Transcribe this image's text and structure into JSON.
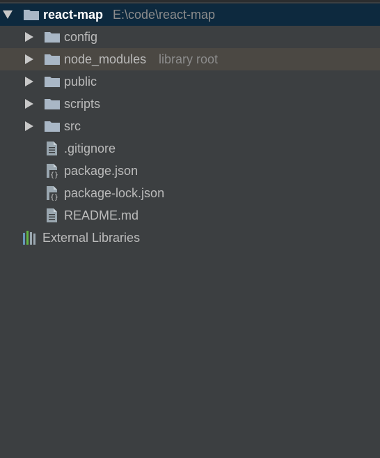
{
  "project_tree": {
    "root": {
      "name": "react-map",
      "path": "E:\\code\\react-map",
      "expanded": true,
      "icon": "folder-icon"
    },
    "folders": [
      {
        "name": "config",
        "hint": "",
        "icon": "folder-icon"
      },
      {
        "name": "node_modules",
        "hint": "library root",
        "icon": "folder-icon"
      },
      {
        "name": "public",
        "hint": "",
        "icon": "folder-icon"
      },
      {
        "name": "scripts",
        "hint": "",
        "icon": "folder-icon"
      },
      {
        "name": "src",
        "hint": "",
        "icon": "folder-icon"
      }
    ],
    "files": [
      {
        "name": ".gitignore",
        "icon": "text-file-icon"
      },
      {
        "name": "package.json",
        "icon": "json-file-icon"
      },
      {
        "name": "package-lock.json",
        "icon": "json-file-icon"
      },
      {
        "name": "README.md",
        "icon": "text-file-icon"
      }
    ],
    "external_libraries": {
      "name": "External Libraries",
      "icon": "libraries-icon"
    }
  },
  "colors": {
    "background": "#3c3f41",
    "selected_row": "#0d293e",
    "hover_row": "#4b4843",
    "text": "#bbbbbb",
    "hint_text": "#8c8c8c",
    "folder": "#a9b7c6"
  }
}
